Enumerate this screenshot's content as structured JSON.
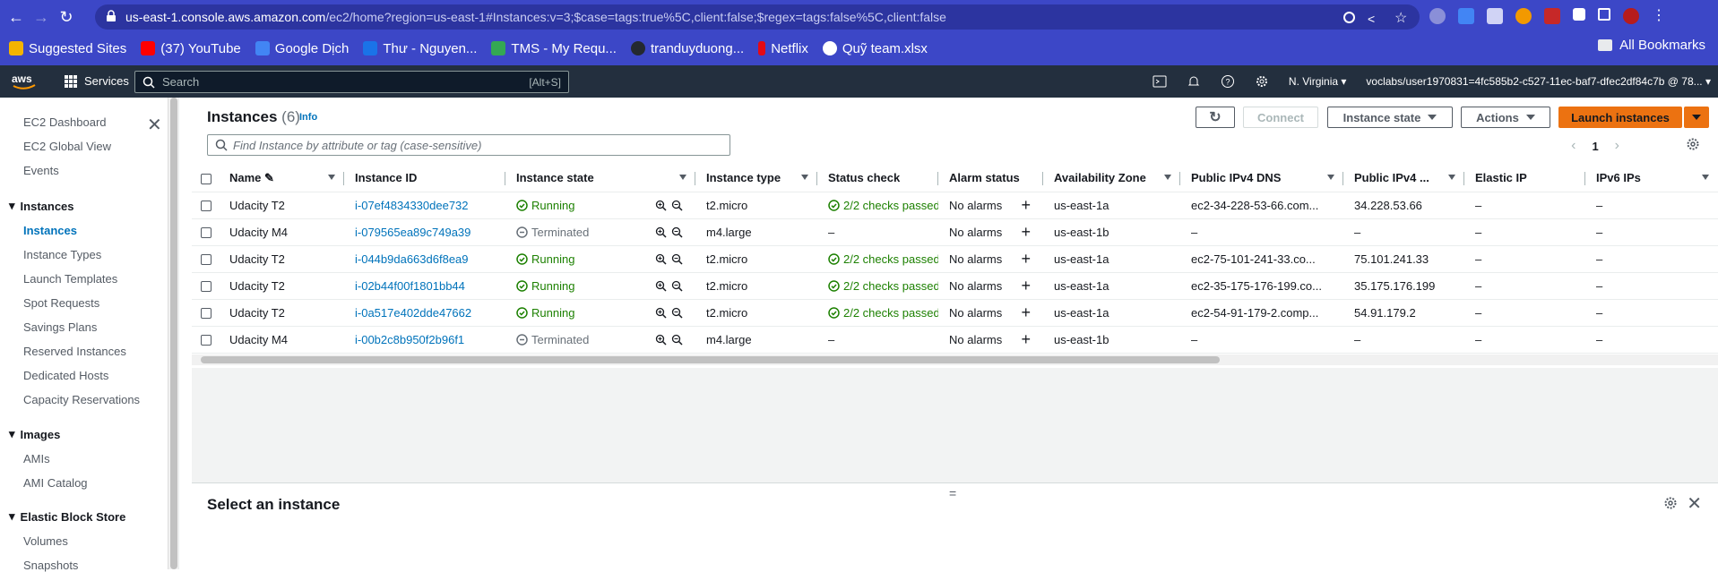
{
  "browser": {
    "url_host": "us-east-1.console.aws.amazon.com",
    "url_rest": "/ec2/home?region=us-east-1#Instances:v=3;$case=tags:true%5C,client:false;$regex=tags:false%5C,client:false",
    "bookmarks": [
      {
        "label": "Suggested Sites",
        "color": "#f4b400"
      },
      {
        "label": "(37) YouTube",
        "color": "#ff0000"
      },
      {
        "label": "Google Dịch",
        "color": "#4285f4"
      },
      {
        "label": "Thư - Nguyen...",
        "color": "#1a73e8"
      },
      {
        "label": "TMS - My Requ...",
        "color": "#34a853"
      },
      {
        "label": "tranduyduong...",
        "color": "#24292f"
      },
      {
        "label": "Netflix",
        "color": "#e50914"
      },
      {
        "label": "Quỹ team.xlsx",
        "color": "#ffffff"
      }
    ],
    "all_bookmarks": "All Bookmarks"
  },
  "aws": {
    "services": "Services",
    "search_placeholder": "Search",
    "search_shortcut": "[Alt+S]",
    "region": "N. Virginia",
    "account": "voclabs/user1970831=4fc585b2-c527-11ec-baf7-dfec2df84c7b @ 78..."
  },
  "sidebar": {
    "top": [
      "EC2 Dashboard",
      "EC2 Global View",
      "Events"
    ],
    "instances_head": "Instances",
    "instances": [
      "Instances",
      "Instance Types",
      "Launch Templates",
      "Spot Requests",
      "Savings Plans",
      "Reserved Instances",
      "Dedicated Hosts",
      "Capacity Reservations"
    ],
    "images_head": "Images",
    "images": [
      "AMIs",
      "AMI Catalog"
    ],
    "ebs_head": "Elastic Block Store",
    "ebs": [
      "Volumes",
      "Snapshots"
    ]
  },
  "panel": {
    "title": "Instances",
    "count": "(6)",
    "info": "Info",
    "connect": "Connect",
    "instance_state": "Instance state",
    "actions": "Actions",
    "launch": "Launch instances",
    "filter_placeholder": "Find Instance by attribute or tag (case-sensitive)",
    "page": "1"
  },
  "table": {
    "headers": [
      "Name",
      "Instance ID",
      "Instance state",
      "Instance type",
      "Status check",
      "Alarm status",
      "Availability Zone",
      "Public IPv4 DNS",
      "Public IPv4 ...",
      "Elastic IP",
      "IPv6 IPs"
    ],
    "rows": [
      {
        "name": "Udacity T2",
        "id": "i-07ef4834330dee732",
        "state": "Running",
        "type": "t2.micro",
        "status": "2/2 checks passed",
        "alarm": "No alarms",
        "az": "us-east-1a",
        "dns": "ec2-34-228-53-66.com...",
        "ip": "34.228.53.66",
        "eip": "–",
        "ipv6": "–"
      },
      {
        "name": "Udacity M4",
        "id": "i-079565ea89c749a39",
        "state": "Terminated",
        "type": "m4.large",
        "status": "–",
        "alarm": "No alarms",
        "az": "us-east-1b",
        "dns": "–",
        "ip": "–",
        "eip": "–",
        "ipv6": "–"
      },
      {
        "name": "Udacity T2",
        "id": "i-044b9da663d6f8ea9",
        "state": "Running",
        "type": "t2.micro",
        "status": "2/2 checks passed",
        "alarm": "No alarms",
        "az": "us-east-1a",
        "dns": "ec2-75-101-241-33.co...",
        "ip": "75.101.241.33",
        "eip": "–",
        "ipv6": "–"
      },
      {
        "name": "Udacity T2",
        "id": "i-02b44f00f1801bb44",
        "state": "Running",
        "type": "t2.micro",
        "status": "2/2 checks passed",
        "alarm": "No alarms",
        "az": "us-east-1a",
        "dns": "ec2-35-175-176-199.co...",
        "ip": "35.175.176.199",
        "eip": "–",
        "ipv6": "–"
      },
      {
        "name": "Udacity T2",
        "id": "i-0a517e402dde47662",
        "state": "Running",
        "type": "t2.micro",
        "status": "2/2 checks passed",
        "alarm": "No alarms",
        "az": "us-east-1a",
        "dns": "ec2-54-91-179-2.comp...",
        "ip": "54.91.179.2",
        "eip": "–",
        "ipv6": "–"
      },
      {
        "name": "Udacity M4",
        "id": "i-00b2c8b950f2b96f1",
        "state": "Terminated",
        "type": "m4.large",
        "status": "–",
        "alarm": "No alarms",
        "az": "us-east-1b",
        "dns": "–",
        "ip": "–",
        "eip": "–",
        "ipv6": "–"
      }
    ]
  },
  "details": {
    "title": "Select an instance",
    "handle": "="
  }
}
